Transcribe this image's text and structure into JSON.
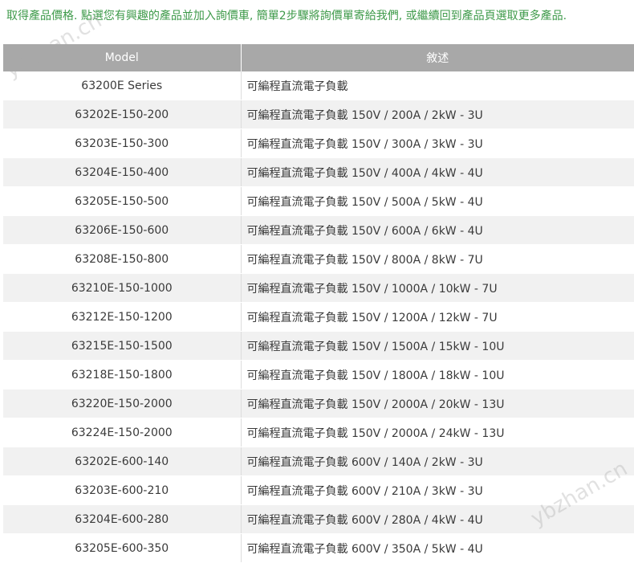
{
  "intro_text": "取得產品價格. 點選您有興趣的產品並加入詢價車, 簡單2步驟將詢價單寄給我們, 或繼續回到產品頁選取更多產品.",
  "table": {
    "headers": [
      "Model",
      "敘述"
    ],
    "rows": [
      {
        "model": "63200E Series",
        "desc": "可編程直流電子負載"
      },
      {
        "model": "63202E-150-200",
        "desc": "可編程直流電子負載 150V / 200A / 2kW - 3U"
      },
      {
        "model": "63203E-150-300",
        "desc": "可編程直流電子負載 150V / 300A / 3kW - 3U"
      },
      {
        "model": "63204E-150-400",
        "desc": "可編程直流電子負載 150V / 400A / 4kW - 4U"
      },
      {
        "model": "63205E-150-500",
        "desc": "可編程直流電子負載 150V / 500A / 5kW - 4U"
      },
      {
        "model": "63206E-150-600",
        "desc": "可編程直流電子負載 150V / 600A / 6kW - 4U"
      },
      {
        "model": "63208E-150-800",
        "desc": "可編程直流電子負載 150V / 800A / 8kW - 7U"
      },
      {
        "model": "63210E-150-1000",
        "desc": "可編程直流電子負載 150V / 1000A / 10kW - 7U"
      },
      {
        "model": "63212E-150-1200",
        "desc": "可編程直流電子負載 150V / 1200A / 12kW - 7U"
      },
      {
        "model": "63215E-150-1500",
        "desc": "可編程直流電子負載 150V / 1500A / 15kW - 10U"
      },
      {
        "model": "63218E-150-1800",
        "desc": "可編程直流電子負載 150V / 1800A / 18kW - 10U"
      },
      {
        "model": "63220E-150-2000",
        "desc": "可編程直流電子負載 150V / 2000A / 20kW - 13U"
      },
      {
        "model": "63224E-150-2000",
        "desc": "可編程直流電子負載 150V / 2000A / 24kW - 13U"
      },
      {
        "model": "63202E-600-140",
        "desc": "可編程直流電子負載 600V / 140A / 2kW - 3U"
      },
      {
        "model": "63203E-600-210",
        "desc": "可編程直流電子負載 600V / 210A / 3kW - 3U"
      },
      {
        "model": "63204E-600-280",
        "desc": "可編程直流電子負載 600V / 280A / 4kW - 4U"
      },
      {
        "model": "63205E-600-350",
        "desc": "可編程直流電子負載 600V / 350A / 5kW - 4U"
      }
    ]
  },
  "watermark_text": "ybzhan.cn",
  "colors": {
    "intro_text": "#3e9a4a",
    "header_bg": "#a8a8a8",
    "row_alt_bg": "#f1f1f1"
  }
}
